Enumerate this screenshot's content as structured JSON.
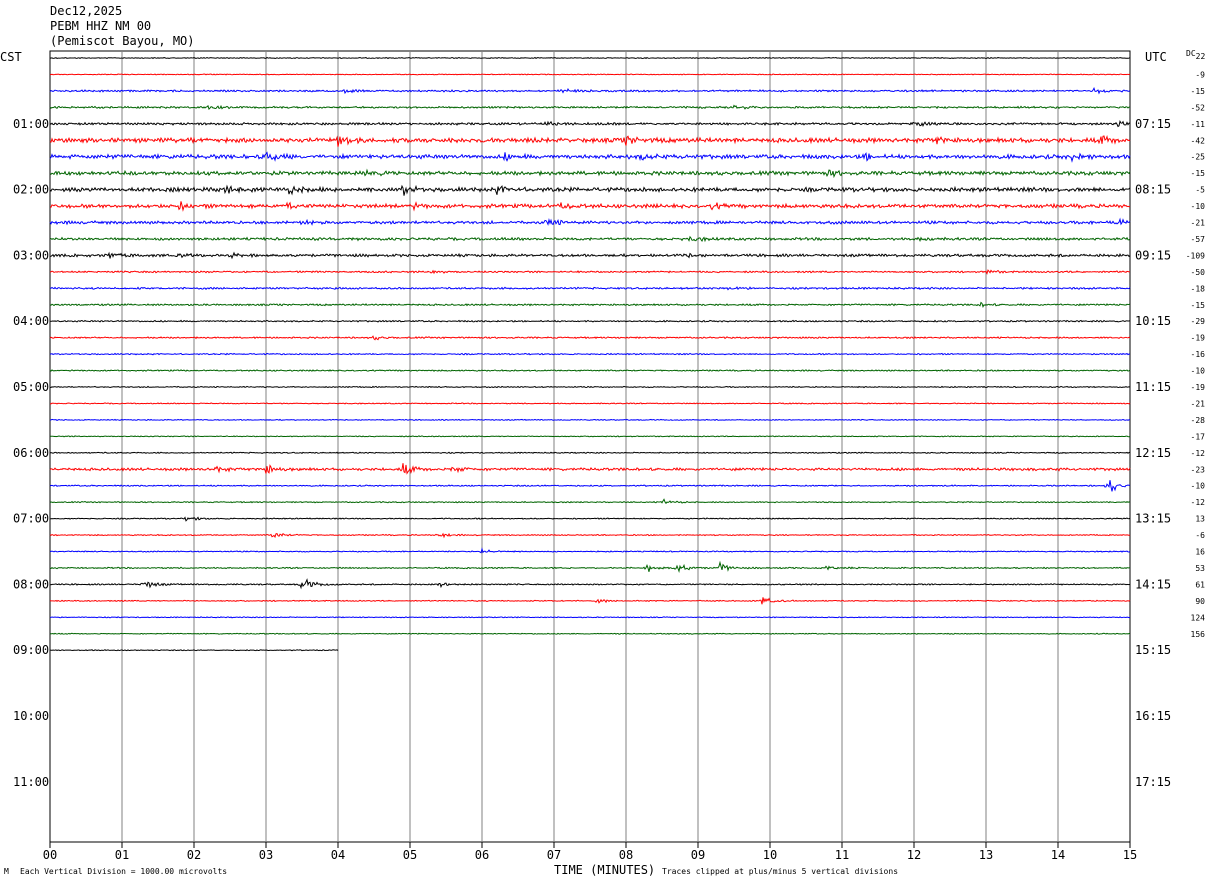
{
  "header": {
    "date": "Dec12,2025",
    "station": "PEBM HHZ NM 00",
    "location": "(Pemiscot Bayou, MO)",
    "left_zone": "CST",
    "right_zone": "UTC",
    "dc_label": "DC",
    "dc_sub": "22"
  },
  "footer": {
    "scale_note": "Each Vertical Division = 1000.00 microvolts",
    "xlabel": "TIME (MINUTES)",
    "clip_note": "Traces clipped at plus/minus 5 vertical divisions",
    "corner_mark": "M"
  },
  "chart_data": {
    "type": "line",
    "title": "PEBM HHZ NM 00 (Pemiscot Bayou, MO) Dec12,2025",
    "xlabel": "TIME (MINUTES)",
    "xlim": [
      0,
      15
    ],
    "x_ticks": [
      "00",
      "01",
      "02",
      "03",
      "04",
      "05",
      "06",
      "07",
      "08",
      "09",
      "10",
      "11",
      "12",
      "13",
      "14",
      "15"
    ],
    "rows_per_hour": 4,
    "minutes_per_row": 15,
    "grid": true,
    "colors": [
      "#000000",
      "#ff0000",
      "#0000ff",
      "#006400"
    ],
    "left_hour_labels": [
      "01:00",
      "02:00",
      "03:00",
      "04:00",
      "05:00",
      "06:00",
      "07:00",
      "08:00",
      "09:00",
      "10:00",
      "11:00"
    ],
    "right_hour_labels": [
      "07:15",
      "08:15",
      "09:15",
      "10:15",
      "11:15",
      "12:15",
      "13:15",
      "14:15",
      "15:15",
      "16:15",
      "17:15"
    ],
    "dc_offsets": [
      "-9",
      "-15",
      "-52",
      "-11",
      "-42",
      "-25",
      "-15",
      "-5",
      "-10",
      "-21",
      "-57",
      "-109",
      "-50",
      "-18",
      "-15",
      "-29",
      "-19",
      "-16",
      "-10",
      "-19",
      "-21",
      "-28",
      "-17",
      "-12",
      "-23",
      "-10",
      "-12",
      "13",
      "-6",
      "16",
      "53",
      "61",
      "90",
      "124",
      "156"
    ],
    "traces": [
      {
        "row": 0,
        "noise": 0.5,
        "end": 15,
        "events": []
      },
      {
        "row": 1,
        "noise": 0.45,
        "end": 15,
        "events": []
      },
      {
        "row": 2,
        "noise": 1.0,
        "end": 15,
        "events": [
          {
            "t": 4.1,
            "a": 2
          },
          {
            "t": 7.1,
            "a": 2
          },
          {
            "t": 14.5,
            "a": 2.5
          }
        ]
      },
      {
        "row": 3,
        "noise": 1.0,
        "end": 15,
        "events": [
          {
            "t": 2.2,
            "a": 2
          },
          {
            "t": 9.5,
            "a": 1.8
          }
        ]
      },
      {
        "row": 4,
        "noise": 1.2,
        "end": 15,
        "events": [
          {
            "t": 12.0,
            "a": 4
          },
          {
            "t": 6.9,
            "a": 2
          },
          {
            "t": 14.8,
            "a": 3
          }
        ]
      },
      {
        "row": 5,
        "noise": 2.4,
        "end": 15,
        "events": [
          {
            "t": 4.0,
            "a": 5
          },
          {
            "t": 8.0,
            "a": 3.5
          },
          {
            "t": 12.3,
            "a": 3
          },
          {
            "t": 14.6,
            "a": 4
          }
        ]
      },
      {
        "row": 6,
        "noise": 2.2,
        "end": 15,
        "events": [
          {
            "t": 3.0,
            "a": 5
          },
          {
            "t": 6.3,
            "a": 3
          },
          {
            "t": 8.2,
            "a": 3
          },
          {
            "t": 11.3,
            "a": 3.5
          },
          {
            "t": 14.2,
            "a": 3.5
          }
        ]
      },
      {
        "row": 7,
        "noise": 2.0,
        "end": 15,
        "events": [
          {
            "t": 4.4,
            "a": 3
          },
          {
            "t": 10.8,
            "a": 3
          }
        ]
      },
      {
        "row": 8,
        "noise": 2.2,
        "end": 15,
        "events": [
          {
            "t": 2.4,
            "a": 4
          },
          {
            "t": 3.3,
            "a": 4
          },
          {
            "t": 4.9,
            "a": 5
          },
          {
            "t": 6.2,
            "a": 3.5
          }
        ]
      },
      {
        "row": 9,
        "noise": 2.0,
        "end": 15,
        "events": [
          {
            "t": 1.8,
            "a": 3.5
          },
          {
            "t": 3.3,
            "a": 3
          },
          {
            "t": 5.0,
            "a": 3
          },
          {
            "t": 7.1,
            "a": 3
          },
          {
            "t": 9.2,
            "a": 3
          }
        ]
      },
      {
        "row": 10,
        "noise": 1.6,
        "end": 15,
        "events": [
          {
            "t": 6.9,
            "a": 5
          },
          {
            "t": 14.8,
            "a": 4
          },
          {
            "t": 3.5,
            "a": 2
          }
        ]
      },
      {
        "row": 11,
        "noise": 1.4,
        "end": 15,
        "events": [
          {
            "t": 8.9,
            "a": 2.5
          },
          {
            "t": 12.1,
            "a": 2
          }
        ]
      },
      {
        "row": 12,
        "noise": 1.4,
        "end": 15,
        "events": [
          {
            "t": 0.8,
            "a": 3.5
          },
          {
            "t": 1.8,
            "a": 2.5
          },
          {
            "t": 2.5,
            "a": 2.5
          },
          {
            "t": 8.8,
            "a": 2
          }
        ]
      },
      {
        "row": 13,
        "noise": 0.9,
        "end": 15,
        "events": [
          {
            "t": 5.3,
            "a": 2
          },
          {
            "t": 13.0,
            "a": 2
          }
        ]
      },
      {
        "row": 14,
        "noise": 1.0,
        "end": 15,
        "events": [
          {
            "t": 9.4,
            "a": 2
          }
        ]
      },
      {
        "row": 15,
        "noise": 0.9,
        "end": 15,
        "events": [
          {
            "t": 12.9,
            "a": 2
          }
        ]
      },
      {
        "row": 16,
        "noise": 0.8,
        "end": 15,
        "events": []
      },
      {
        "row": 17,
        "noise": 0.8,
        "end": 15,
        "events": [
          {
            "t": 4.5,
            "a": 2
          }
        ]
      },
      {
        "row": 18,
        "noise": 0.7,
        "end": 15,
        "events": []
      },
      {
        "row": 19,
        "noise": 0.7,
        "end": 15,
        "events": []
      },
      {
        "row": 20,
        "noise": 0.6,
        "end": 15,
        "events": []
      },
      {
        "row": 21,
        "noise": 0.55,
        "end": 15,
        "events": []
      },
      {
        "row": 22,
        "noise": 0.5,
        "end": 15,
        "events": []
      },
      {
        "row": 23,
        "noise": 0.5,
        "end": 15,
        "events": []
      },
      {
        "row": 24,
        "noise": 0.6,
        "end": 15,
        "events": []
      },
      {
        "row": 25,
        "noise": 1.4,
        "end": 15,
        "events": [
          {
            "t": 3.0,
            "a": 5
          },
          {
            "t": 4.9,
            "a": 6
          },
          {
            "t": 5.6,
            "a": 4
          },
          {
            "t": 2.3,
            "a": 3
          }
        ]
      },
      {
        "row": 26,
        "noise": 0.7,
        "end": 15,
        "events": [
          {
            "t": 14.7,
            "a": 8
          }
        ]
      },
      {
        "row": 27,
        "noise": 0.6,
        "end": 15,
        "events": [
          {
            "t": 8.5,
            "a": 3
          }
        ]
      },
      {
        "row": 28,
        "noise": 0.6,
        "end": 15,
        "events": [
          {
            "t": 1.9,
            "a": 3
          }
        ]
      },
      {
        "row": 29,
        "noise": 0.6,
        "end": 15,
        "events": [
          {
            "t": 3.1,
            "a": 3.5
          },
          {
            "t": 5.4,
            "a": 2.5
          }
        ]
      },
      {
        "row": 30,
        "noise": 0.6,
        "end": 15,
        "events": [
          {
            "t": 6.0,
            "a": 2.5
          }
        ]
      },
      {
        "row": 31,
        "noise": 0.7,
        "end": 15,
        "events": [
          {
            "t": 8.3,
            "a": 4
          },
          {
            "t": 8.7,
            "a": 5
          },
          {
            "t": 9.3,
            "a": 5
          },
          {
            "t": 10.8,
            "a": 3
          }
        ]
      },
      {
        "row": 32,
        "noise": 0.7,
        "end": 15,
        "events": [
          {
            "t": 1.3,
            "a": 5
          },
          {
            "t": 3.5,
            "a": 8
          },
          {
            "t": 5.4,
            "a": 3
          }
        ]
      },
      {
        "row": 33,
        "noise": 0.6,
        "end": 15,
        "events": [
          {
            "t": 9.9,
            "a": 7
          },
          {
            "t": 7.6,
            "a": 2
          }
        ]
      },
      {
        "row": 34,
        "noise": 0.5,
        "end": 15,
        "events": []
      },
      {
        "row": 35,
        "noise": 0.5,
        "end": 15,
        "events": []
      },
      {
        "row": 36,
        "noise": 0.5,
        "end": 4,
        "events": []
      }
    ]
  }
}
